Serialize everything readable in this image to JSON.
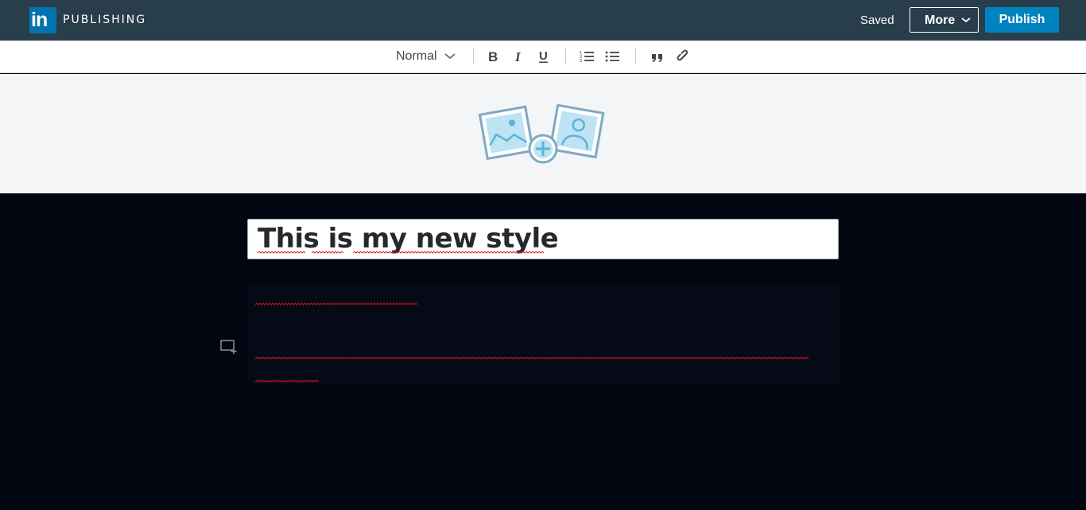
{
  "header": {
    "logo_text": "in",
    "brand": "PUBLISHING",
    "status": "Saved",
    "more_label": "More",
    "publish_label": "Publish"
  },
  "toolbar": {
    "style_value": "Normal",
    "icons": [
      "bold-icon",
      "italic-icon",
      "underline-icon",
      "numbered-list-icon",
      "bulleted-list-icon",
      "quote-icon",
      "link-icon"
    ]
  },
  "cover": {
    "icon": "add-cover-image-icon"
  },
  "editor": {
    "headline": "This is my new style",
    "side_icon": "insert-media-icon"
  },
  "colors": {
    "topbar": "#283e4a",
    "brand_blue": "#0073b1",
    "publish_blue": "#0084bf",
    "editor_bg": "#020611",
    "cover_bg": "#f3f5f7",
    "spellcheck": "#e0151c"
  }
}
